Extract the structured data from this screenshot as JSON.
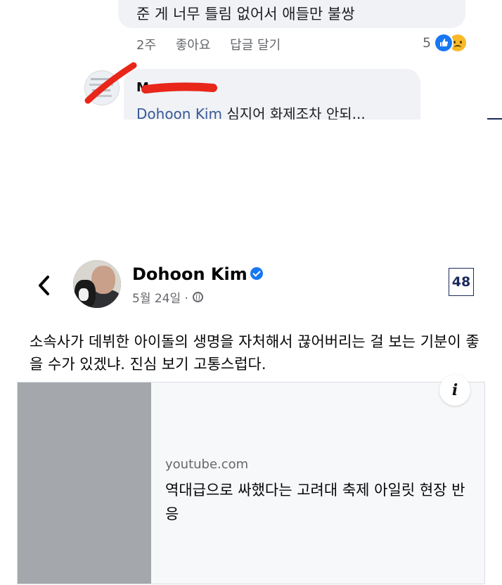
{
  "comment_top": {
    "text": "준 게 너무 틀림 없어서 애들만 불쌍",
    "time": "2주",
    "like_label": "좋아요",
    "reply_label": "답글 달기",
    "reaction_count": "5",
    "reaction_icons": [
      "like-icon",
      "sad-icon"
    ]
  },
  "comment_reply": {
    "author_name": "M",
    "mention": "Dohoon Kim",
    "text": " 심지어 화제조차 안되..."
  },
  "post": {
    "author": "Dohoon Kim",
    "date": "5월 24일 ·",
    "badge_count": "48",
    "text": "소속사가 데뷔한 아이돌의 생명을 자처해서 끊어버리는 걸 보는 기분이 좋을 수가 있겠냐. 진심 보기 고통스럽다."
  },
  "link_card": {
    "domain": "youtube.com",
    "title": "역대급으로 싸했다는 고려대 축제 아일릿 현장 반응",
    "info_icon": "i"
  },
  "colors": {
    "link_blue": "#385898",
    "facebook_blue": "#1877f2",
    "bubble_bg": "#f0f2f5",
    "redaction_red": "#e8261a"
  }
}
